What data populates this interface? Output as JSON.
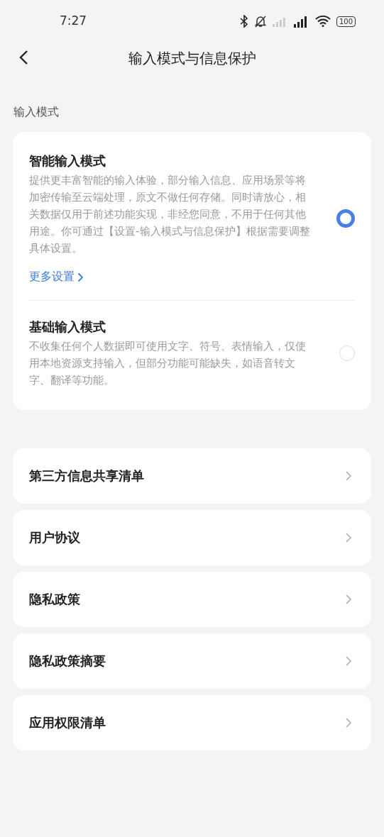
{
  "status_bar": {
    "time": "7:27",
    "battery": "100"
  },
  "header": {
    "title": "输入模式与信息保护"
  },
  "section": {
    "label": "输入模式"
  },
  "modes": [
    {
      "title": "智能输入模式",
      "description": "提供更丰富智能的输入体验，部分输入信息、应用场景等将加密传输至云端处理，原文不做任何存储。同时请放心，相关数据仅用于前述功能实现，非经您同意，不用于任何其他用途。你可通过【设置-输入模式与信息保护】根据需要调整具体设置。",
      "link": "更多设置",
      "selected": true
    },
    {
      "title": "基础输入模式",
      "description": "不收集任何个人数据即可使用文字、符号、表情输入，仅使用本地资源支持输入，但部分功能可能缺失，如语音转文字、翻译等功能。",
      "selected": false
    }
  ],
  "links": [
    {
      "label": "第三方信息共享清单"
    },
    {
      "label": "用户协议"
    },
    {
      "label": "隐私政策"
    },
    {
      "label": "隐私政策摘要"
    },
    {
      "label": "应用权限清单"
    }
  ]
}
